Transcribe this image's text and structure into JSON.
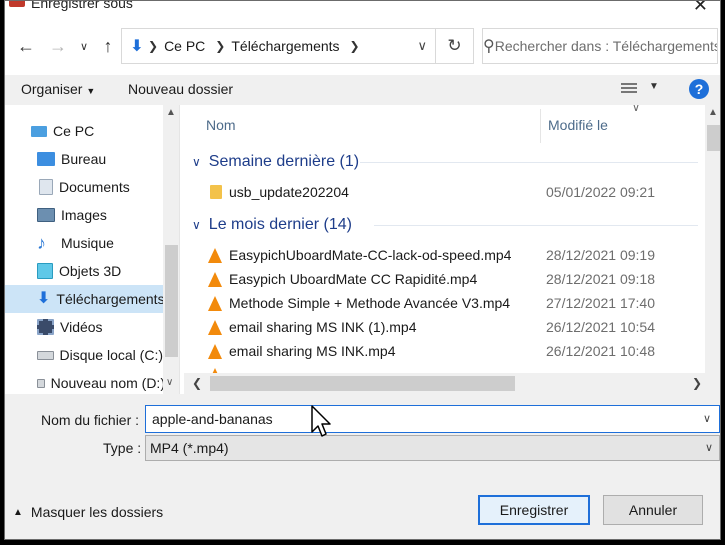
{
  "window": {
    "title": "Enregistrer sous",
    "close_glyph": "✕"
  },
  "nav": {
    "breadcrumbs": [
      "Ce PC",
      "Téléchargements"
    ],
    "search_placeholder": "Rechercher dans : Téléchargements"
  },
  "toolbar": {
    "organize_label": "Organiser",
    "new_folder_label": "Nouveau dossier",
    "help_label": "?"
  },
  "sidebar": {
    "items": [
      {
        "label": "Ce PC",
        "icon": "computer-icon"
      },
      {
        "label": "Bureau",
        "icon": "desktop-icon"
      },
      {
        "label": "Documents",
        "icon": "documents-icon"
      },
      {
        "label": "Images",
        "icon": "pictures-icon"
      },
      {
        "label": "Musique",
        "icon": "music-icon"
      },
      {
        "label": "Objets 3D",
        "icon": "3d-objects-icon"
      },
      {
        "label": "Téléchargements",
        "icon": "downloads-icon",
        "selected": true
      },
      {
        "label": "Vidéos",
        "icon": "videos-icon"
      },
      {
        "label": "Disque local (C:)",
        "icon": "drive-icon"
      },
      {
        "label": "Nouveau nom (D:)",
        "icon": "drive-icon"
      }
    ]
  },
  "files": {
    "columns": {
      "name": "Nom",
      "modified": "Modifié le"
    },
    "groups": [
      {
        "title": "Semaine dernière (1)",
        "items": [
          {
            "name": "usb_update202204",
            "date": "05/01/2022 09:21",
            "type": "folder"
          }
        ]
      },
      {
        "title": "Le mois dernier (14)",
        "items": [
          {
            "name": "EasypichUboardMate-CC-lack-od-speed.mp4",
            "date": "28/12/2021 09:19",
            "type": "video"
          },
          {
            "name": "Easypich  UboardMate CC Rapidité.mp4",
            "date": "28/12/2021 09:18",
            "type": "video"
          },
          {
            "name": "Methode Simple + Methode Avancée V3.mp4",
            "date": "27/12/2021 17:40",
            "type": "video"
          },
          {
            "name": "email sharing  MS INK (1).mp4",
            "date": "26/12/2021 10:54",
            "type": "video"
          },
          {
            "name": "email sharing  MS INK.mp4",
            "date": "26/12/2021 10:48",
            "type": "video"
          }
        ]
      }
    ]
  },
  "form": {
    "filename_label": "Nom du fichier :",
    "filename_value": "apple-and-bananas",
    "type_label": "Type :",
    "type_value": "MP4 (*.mp4)"
  },
  "footer": {
    "hide_folders_label": "Masquer les dossiers",
    "save_label": "Enregistrer",
    "cancel_label": "Annuler"
  },
  "colors": {
    "accent": "#1e6fd9",
    "selection": "#cce4f7",
    "group_heading": "#1e3d8a"
  }
}
